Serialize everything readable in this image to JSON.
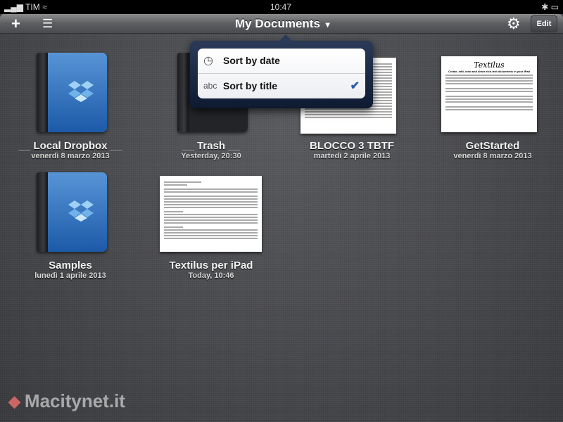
{
  "status": {
    "carrier": "TIM",
    "time": "10:47"
  },
  "toolbar": {
    "title": "My Documents",
    "edit": "Edit"
  },
  "items": [
    {
      "name": "__ Local Dropbox __",
      "date": "venerdì 8 marzo 2013"
    },
    {
      "name": "__ Trash __",
      "date": "Yesterday, 20:30"
    },
    {
      "name": "BLOCCO 3 TBTF",
      "date": "martedì 2 aprile 2013"
    },
    {
      "name": "GetStarted",
      "date": "venerdì 8 marzo 2013"
    },
    {
      "name": "Samples",
      "date": "lunedì 1 aprile 2013"
    },
    {
      "name": "Textilus per iPad",
      "date": "Today, 10:46"
    }
  ],
  "getstarted_doc": {
    "heading": "Textilus",
    "subheading": "Create, edit, view and share rich-text documents in your iPad"
  },
  "sort_menu": {
    "options": [
      {
        "icon": "clock-icon",
        "label": "Sort by date"
      },
      {
        "icon": "abc",
        "label": "Sort by title",
        "selected": true
      }
    ]
  },
  "watermark": "Macitynet.it"
}
